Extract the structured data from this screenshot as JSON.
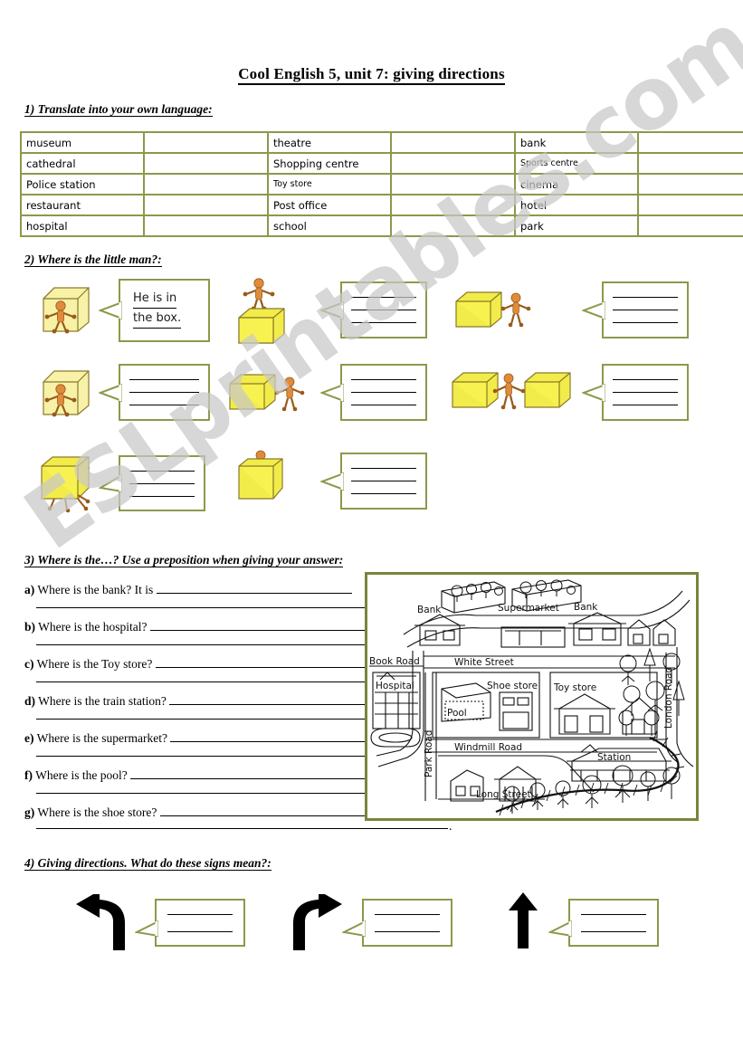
{
  "document": {
    "title": "Cool English 5, unit 7: giving directions",
    "watermark": "ESLprintables.com"
  },
  "theme": {
    "border_olive": "#8a9a4a",
    "map_border": "#77863c",
    "box_yellow": "#f2ec4a",
    "man_orange": "#e08b3c",
    "watermark_gray": "#c9c9c9"
  },
  "section1": {
    "heading": "1) Translate into your own language:",
    "table": {
      "rows": [
        {
          "c1": "museum",
          "c2": "",
          "c3": "theatre",
          "c4": "",
          "c5": "bank",
          "c6": ""
        },
        {
          "c1": "cathedral",
          "c2": "",
          "c3": "Shopping centre",
          "c4": "",
          "c5": "Sports centre",
          "c6": ""
        },
        {
          "c1": "Police station",
          "c2": "",
          "c3": "Toy store",
          "c4": "",
          "c5": "cinema",
          "c6": ""
        },
        {
          "c1": "restaurant",
          "c2": "",
          "c3": "Post office",
          "c4": "",
          "c5": "hotel",
          "c6": ""
        },
        {
          "c1": "hospital",
          "c2": "",
          "c3": "school",
          "c4": "",
          "c5": "park",
          "c6": ""
        }
      ]
    }
  },
  "section2": {
    "heading": "2) Where is the little man?:",
    "example_answer_line1": "He is in",
    "example_answer_line2": "the box.",
    "items": [
      {
        "id": "in-the-box",
        "figure": "man-inside-box",
        "answer": "He is in the box.",
        "answered": true
      },
      {
        "id": "on-the-box",
        "figure": "man-on-top-of-box",
        "answer": "",
        "answered": false
      },
      {
        "id": "next-to-the-box-right",
        "figure": "box-with-man-beside-right",
        "answer": "",
        "answered": false
      },
      {
        "id": "in-the-box-2",
        "figure": "man-inside-box",
        "answer": "",
        "answered": false
      },
      {
        "id": "beside-the-box",
        "figure": "box-with-man-beside",
        "answer": "",
        "answered": false
      },
      {
        "id": "between-the-boxes",
        "figure": "man-between-two-boxes",
        "answer": "",
        "answered": false
      },
      {
        "id": "under-the-box",
        "figure": "man-under-box",
        "answer": "",
        "answered": false
      },
      {
        "id": "behind-the-box",
        "figure": "man-behind-box",
        "answer": "",
        "answered": false
      }
    ]
  },
  "section3": {
    "heading": "3) Where is the…? Use a preposition when giving your answer:",
    "questions": [
      {
        "label": "a)",
        "text": "Where is the bank? It is"
      },
      {
        "label": "b)",
        "text": "Where is the hospital?"
      },
      {
        "label": "c)",
        "text": "Where is the Toy store?"
      },
      {
        "label": "d)",
        "text": "Where is the train station?"
      },
      {
        "label": "e)",
        "text": "Where is the supermarket?"
      },
      {
        "label": "f)",
        "text": "Where is the pool?"
      },
      {
        "label": "g)",
        "text": "Where is the shoe store?"
      }
    ],
    "final_punctuation": ".",
    "map": {
      "labels": {
        "bank_left": "Bank",
        "supermarket": "Supermarket",
        "bank_right": "Bank",
        "book_road": "Book Road",
        "white_street": "White Street",
        "hospital": "Hospital",
        "pool": "Pool",
        "shoe_store": "Shoe store",
        "toy_store": "Toy store",
        "park_road": "Park Road",
        "windmill_road": "Windmill Road",
        "london_road": "London Road",
        "long_street": "Long Street",
        "station": "Station"
      }
    }
  },
  "section4": {
    "heading": "4) Giving directions. What do these signs mean?:",
    "signs": [
      {
        "id": "turn-left",
        "icon": "arrow-curve-left-icon",
        "answer": ""
      },
      {
        "id": "turn-right",
        "icon": "arrow-curve-right-icon",
        "answer": ""
      },
      {
        "id": "go-straight",
        "icon": "arrow-straight-up-icon",
        "answer": ""
      }
    ]
  }
}
